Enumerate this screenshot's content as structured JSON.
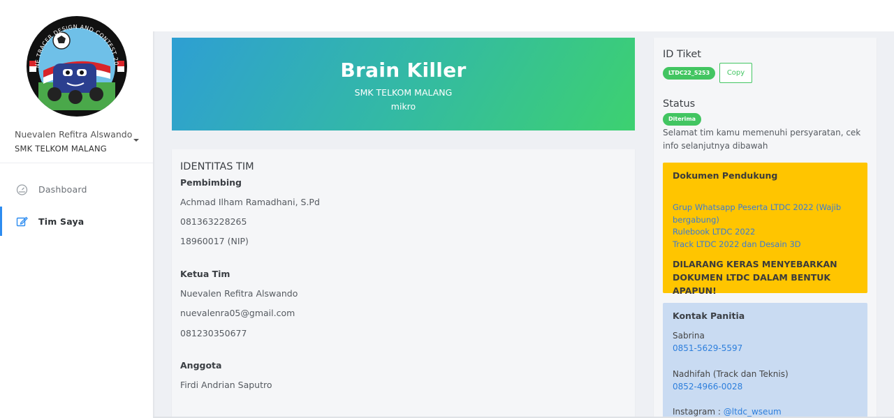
{
  "sidebar": {
    "logo_text": "LINE TRACER DESIGN AND CONTEST 2022",
    "user_name": "Nuevalen Refitra Alswando",
    "user_school": "SMK TELKOM MALANG",
    "items": [
      {
        "label": "Dashboard",
        "icon": "dashboard-icon",
        "active": false
      },
      {
        "label": "Tim Saya",
        "icon": "edit-icon",
        "active": true
      }
    ]
  },
  "banner": {
    "team_name": "Brain Killer",
    "school": "SMK TELKOM MALANG",
    "category": "mikro"
  },
  "identity": {
    "title": "IDENTITAS TIM",
    "pembimbing_label": "Pembimbing",
    "pembimbing_name": "Achmad Ilham Ramadhani, S.Pd",
    "pembimbing_phone": "081363228265",
    "pembimbing_nip": "18960017 (NIP)",
    "ketua_label": "Ketua Tim",
    "ketua_name": "Nuevalen Refitra Alswando",
    "ketua_email": "nuevalenra05@gmail.com",
    "ketua_phone": "081230350677",
    "anggota_label": "Anggota",
    "anggota_name": "Firdi Andrian Saputro"
  },
  "ticket": {
    "title": "ID Tiket",
    "id": "LTDC22_5253",
    "copy_label": "Copy"
  },
  "status": {
    "title": "Status",
    "badge": "Diterima",
    "message": "Selamat tim kamu memenuhi persyaratan, cek info selanjutnya dibawah"
  },
  "documents": {
    "title": "Dokumen Pendukung",
    "links": [
      "Grup Whatsapp Peserta LTDC 2022 (Wajib bergabung)",
      "Rulebook LTDC 2022",
      "Track LTDC 2022 dan Desain 3D"
    ],
    "warning": "DILARANG KERAS MENYEBARKAN DOKUMEN LTDC DALAM BENTUK APAPUN!"
  },
  "contact": {
    "title": "Kontak Panitia",
    "people": [
      {
        "name": "Sabrina",
        "phone": "0851-5629-5597"
      },
      {
        "name": "Nadhifah (Track dan Teknis)",
        "phone": "0852-4966-0028"
      }
    ],
    "instagram_label": "Instagram : ",
    "instagram_handle": "@ltdc_wseum"
  },
  "colors": {
    "accent_blue": "#2d8cf0",
    "success_green": "#42c561",
    "warning_yellow": "#ffc500",
    "contact_blue": "#c9dbf2"
  }
}
